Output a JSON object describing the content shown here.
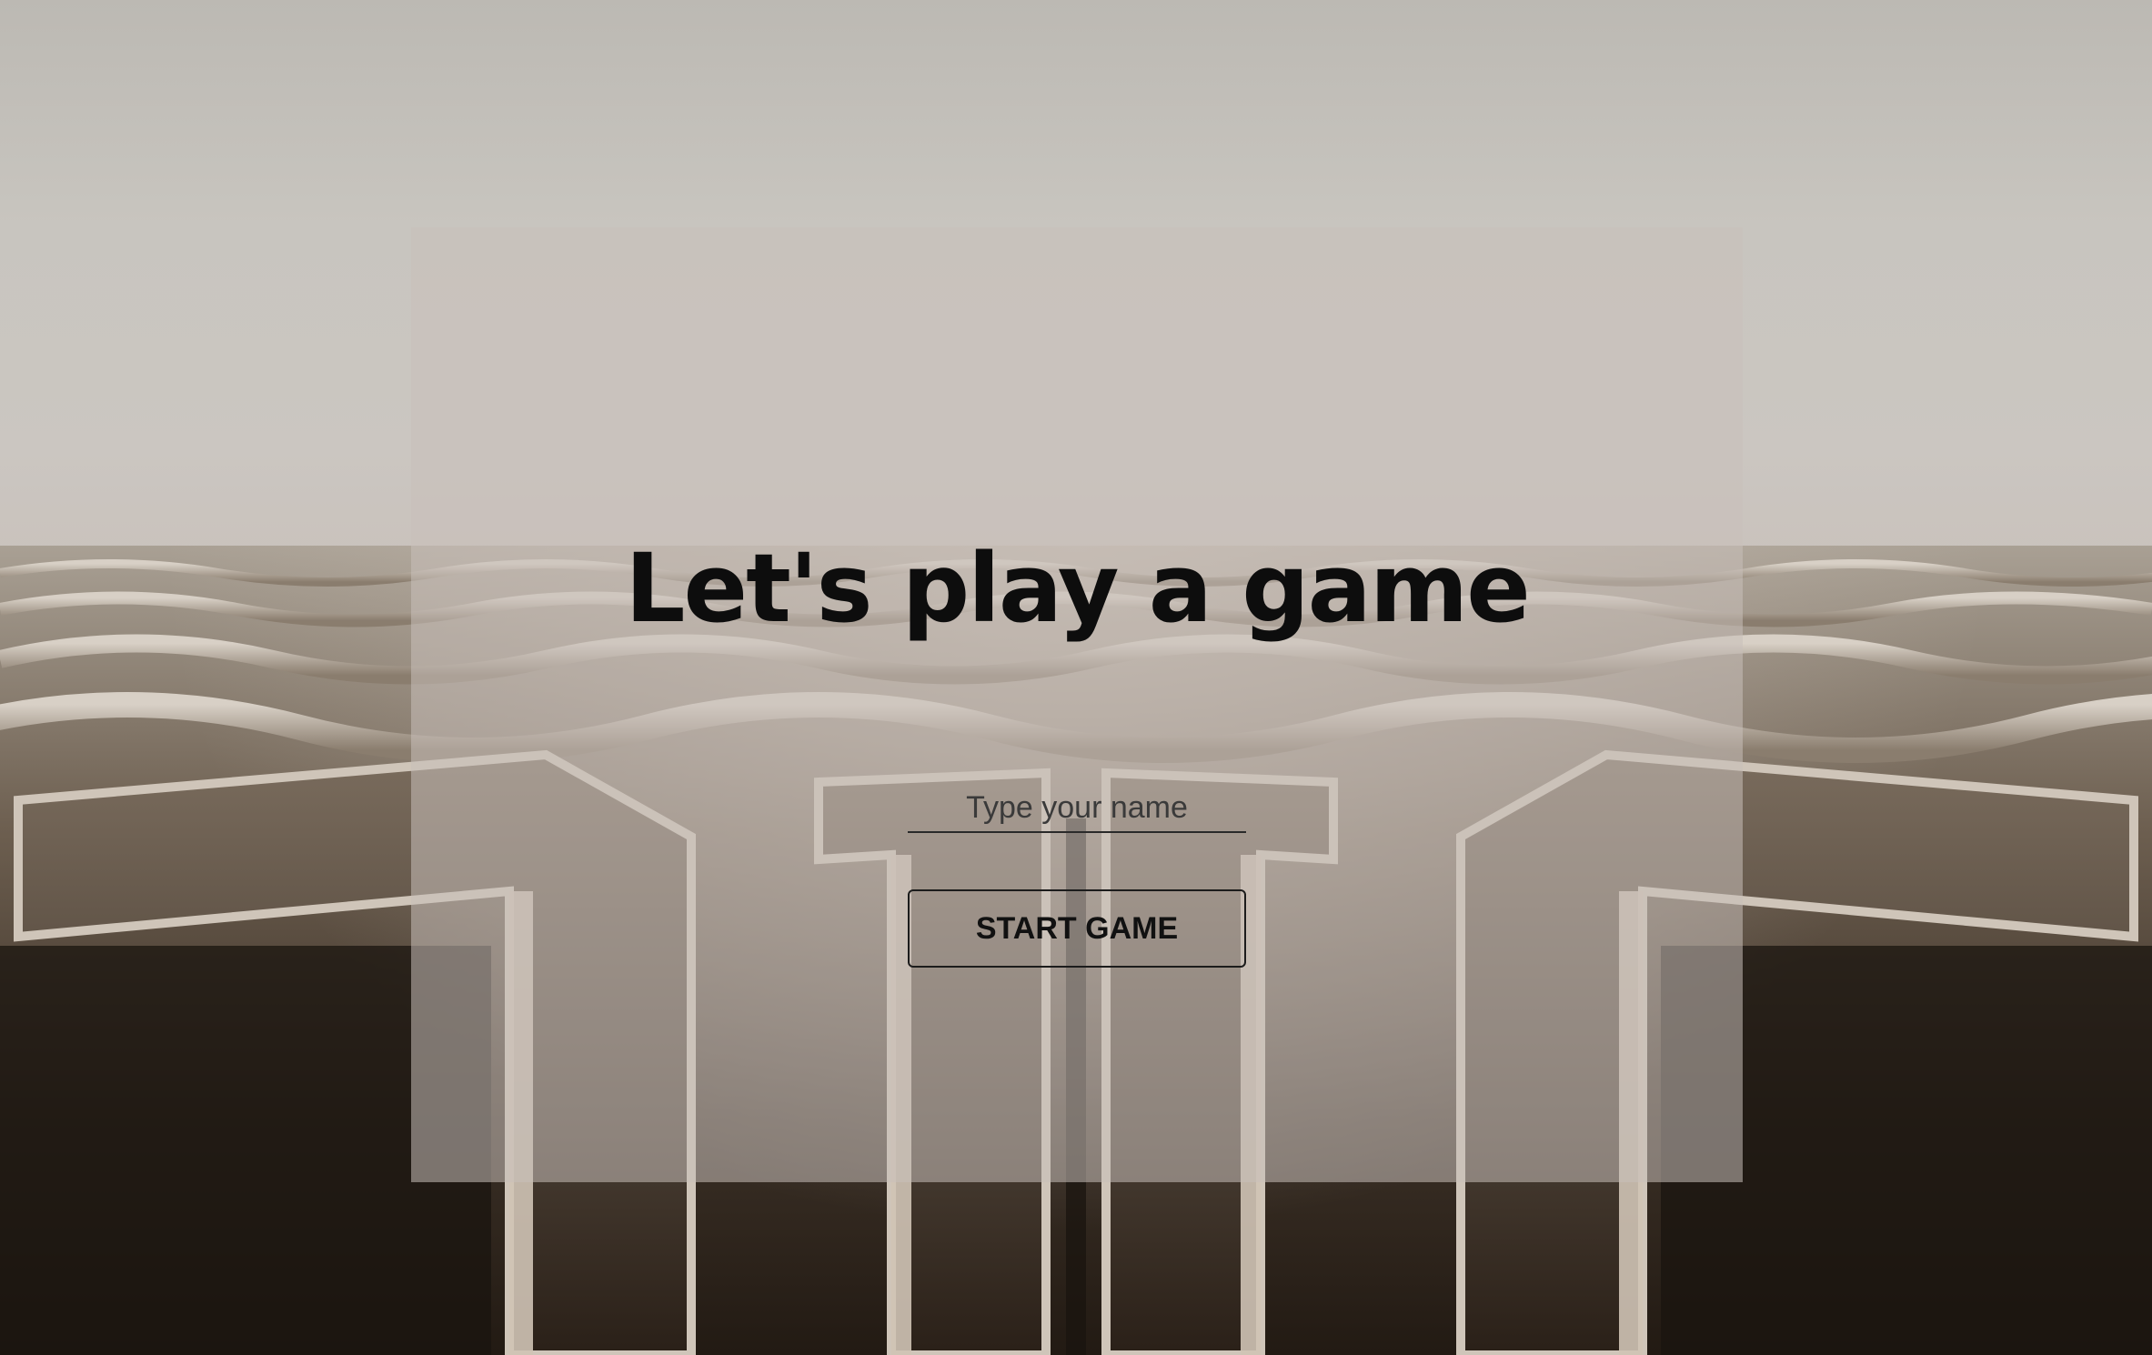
{
  "page": {
    "title": "Let's play a game"
  },
  "form": {
    "name_placeholder": "Type your name",
    "name_value": "",
    "start_label": "START GAME"
  },
  "colors": {
    "panel_overlay": "#c8c0ba",
    "title_text": "#0d0d0d",
    "button_border": "#1c1c1c",
    "sky": "#c8c5bf",
    "maze_shadow": "#2d241c"
  },
  "background": {
    "subject": "concrete-maze-wall-photo"
  }
}
